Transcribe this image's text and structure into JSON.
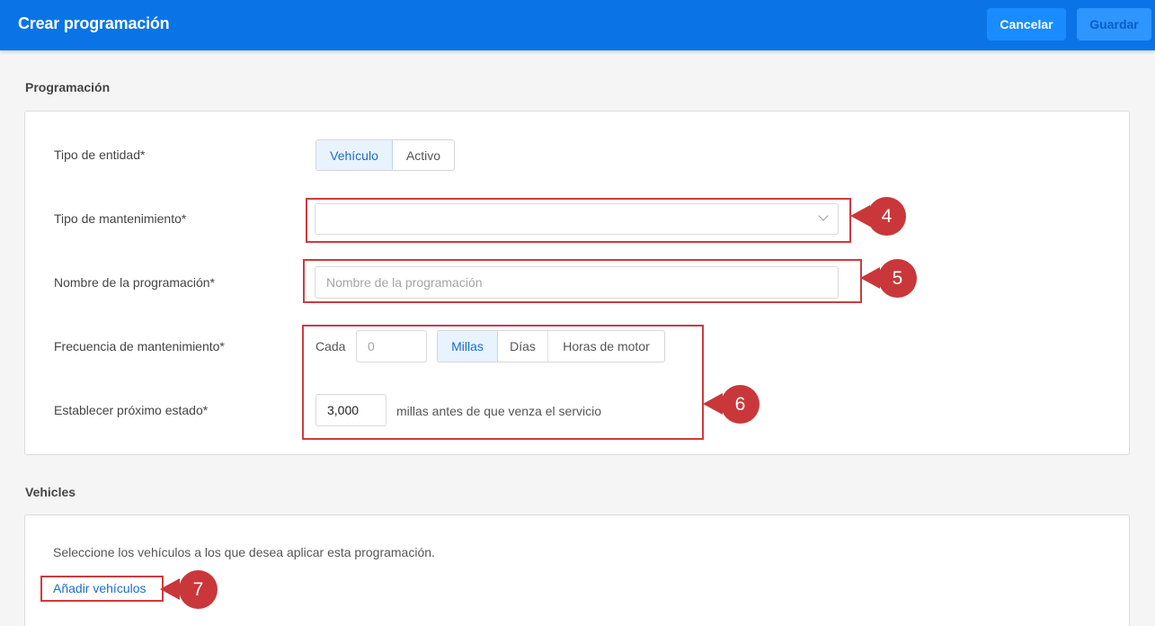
{
  "header": {
    "title": "Crear programación",
    "cancel_label": "Cancelar",
    "save_label": "Guardar"
  },
  "schedule": {
    "section_title": "Programación",
    "entity_type": {
      "label": "Tipo de entidad*",
      "options": [
        "Vehículo",
        "Activo"
      ],
      "selected": "Vehículo"
    },
    "maintenance_type": {
      "label": "Tipo de mantenimiento*",
      "value": ""
    },
    "schedule_name": {
      "label": "Nombre de la programación*",
      "placeholder": "Nombre de la programación"
    },
    "frequency": {
      "label": "Frecuencia de mantenimiento*",
      "every_label": "Cada",
      "every_value": "0",
      "units": [
        "Millas",
        "Días",
        "Horas de motor"
      ],
      "selected_unit": "Millas"
    },
    "next_state": {
      "label": "Establecer próximo estado*",
      "value": "3,000",
      "suffix": "millas antes de que venza el servicio"
    }
  },
  "vehicles": {
    "section_title": "Vehicles",
    "description": "Seleccione los vehículos a los que desea aplicar esta programación.",
    "add_link": "Añadir vehículos"
  },
  "callouts": [
    "4",
    "5",
    "6",
    "7"
  ],
  "colors": {
    "header_bg": "#0a74e6",
    "callout_red": "#c9373a",
    "link_blue": "#1a6ed1"
  }
}
